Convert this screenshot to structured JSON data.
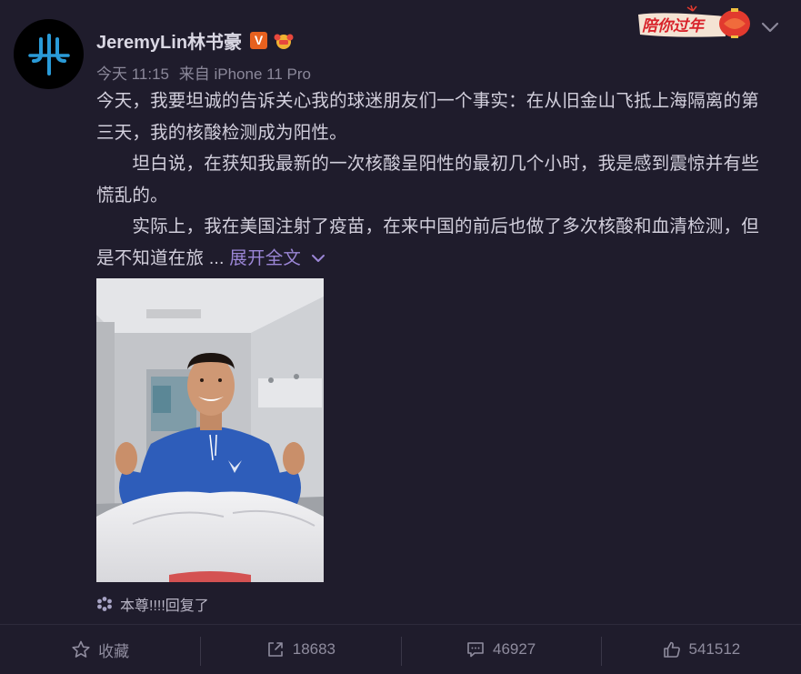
{
  "post": {
    "username": "JeremyLin林书豪",
    "time": "今天 11:15",
    "source": "来自 iPhone 11 Pro",
    "festive_label": "陪你过年",
    "paragraphs": [
      "今天，我要坦诚的告诉关心我的球迷朋友们一个事实：在从旧金山飞抵上海隔离的第三天，我的核酸检测成为阳性。",
      "　　坦白说，在获知我最新的一次核酸呈阳性的最初几个小时，我是感到震惊并有些慌乱的。",
      "　　实际上，我在美国注射了疫苗，在来中国的前后也做了多次核酸和血清检测，但是不知道在旅 ..."
    ],
    "expand_label": "展开全文",
    "reply_note": "本尊!!!!回复了"
  },
  "actions": {
    "favorite_label": "收藏",
    "repost_count": "18683",
    "comment_count": "46927",
    "like_count": "541512"
  },
  "colors": {
    "background": "#1f1c2c",
    "accent": "#9b86d6",
    "verified": "#e7611f"
  },
  "icons": [
    "avatar-logo-icon",
    "verified-v-icon",
    "level-badge-icon",
    "festive-lantern-icon",
    "chevron-down-icon",
    "asterisk-icon",
    "star-icon",
    "share-icon",
    "comment-icon",
    "thumbs-up-icon"
  ]
}
